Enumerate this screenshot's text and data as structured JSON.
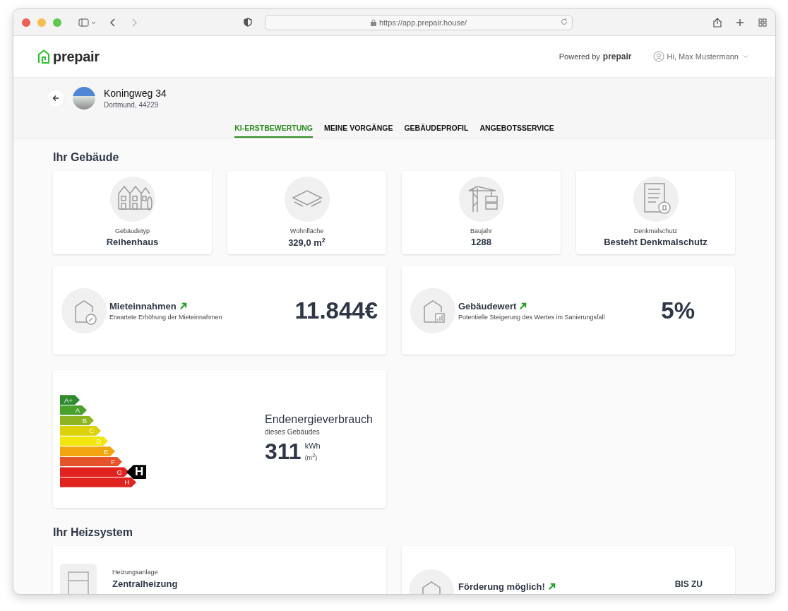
{
  "browser": {
    "url": "https://app.prepair.house/"
  },
  "header": {
    "logo": "prepair",
    "powered_by": "Powered by",
    "powered_brand": "prepair",
    "user": "Hi, Max Mustermann"
  },
  "property": {
    "title": "Koningweg 34",
    "subtitle": "Dortmund, 44229"
  },
  "tabs": [
    {
      "label": "KI-ERSTBEWERTUNG",
      "selected": true
    },
    {
      "label": "MEINE VORGÄNGE",
      "selected": false
    },
    {
      "label": "GEBÄUDEPROFIL",
      "selected": false
    },
    {
      "label": "ANGEBOTSSERVICE",
      "selected": false
    }
  ],
  "building": {
    "heading": "Ihr Gebäude",
    "facts": [
      {
        "kind": "houses",
        "label": "Gebäudetyp",
        "value": "Reihenhaus"
      },
      {
        "kind": "area",
        "label": "Wohnfläche",
        "value": "329,0 m$^{2}$"
      },
      {
        "kind": "crane",
        "label": "Baujahr",
        "value": "1288"
      },
      {
        "kind": "document",
        "label": "Denkmalschutz",
        "value": "Besteht Denkmalschutz"
      }
    ],
    "stats": [
      {
        "kind": "key",
        "title": "Mieteinnahmen",
        "subtitle": "Erwartete Erhöhung der Mieteinnahmen",
        "value": "11.844€"
      },
      {
        "kind": "chart",
        "title": "Gebäudewert",
        "subtitle": "Potentielle Steigerung des Wertes im Sanierungsfall",
        "value": "5%"
      }
    ],
    "energy": {
      "classes": [
        {
          "label": "A+",
          "color": "#2e8b2e",
          "selected": false
        },
        {
          "label": "A",
          "color": "#4aa02c",
          "selected": false
        },
        {
          "label": "B",
          "color": "#8db520",
          "selected": false
        },
        {
          "label": "C",
          "color": "#dcd20a",
          "selected": false
        },
        {
          "label": "D",
          "color": "#f3e60f",
          "selected": false
        },
        {
          "label": "E",
          "color": "#f2a50f",
          "selected": false
        },
        {
          "label": "F",
          "color": "#e4532a",
          "selected": false
        },
        {
          "label": "G",
          "color": "#e0231f",
          "selected": true
        },
        {
          "label": "H",
          "color": "#e0231f",
          "selected": false
        }
      ],
      "marker": "H",
      "title": "Endenergieverbrauch",
      "subtitle": "dieses Gebäudes",
      "value": "311",
      "unit": "kWh",
      "unit_sub": "(m$^{2}$)"
    }
  },
  "heating": {
    "heading": "Ihr Heizsystem",
    "system_label": "Heizungsanlage",
    "system_value": "Zentralheizung",
    "funding_title": "Förderung möglich!",
    "funding_prefix": "BIS ZU"
  }
}
